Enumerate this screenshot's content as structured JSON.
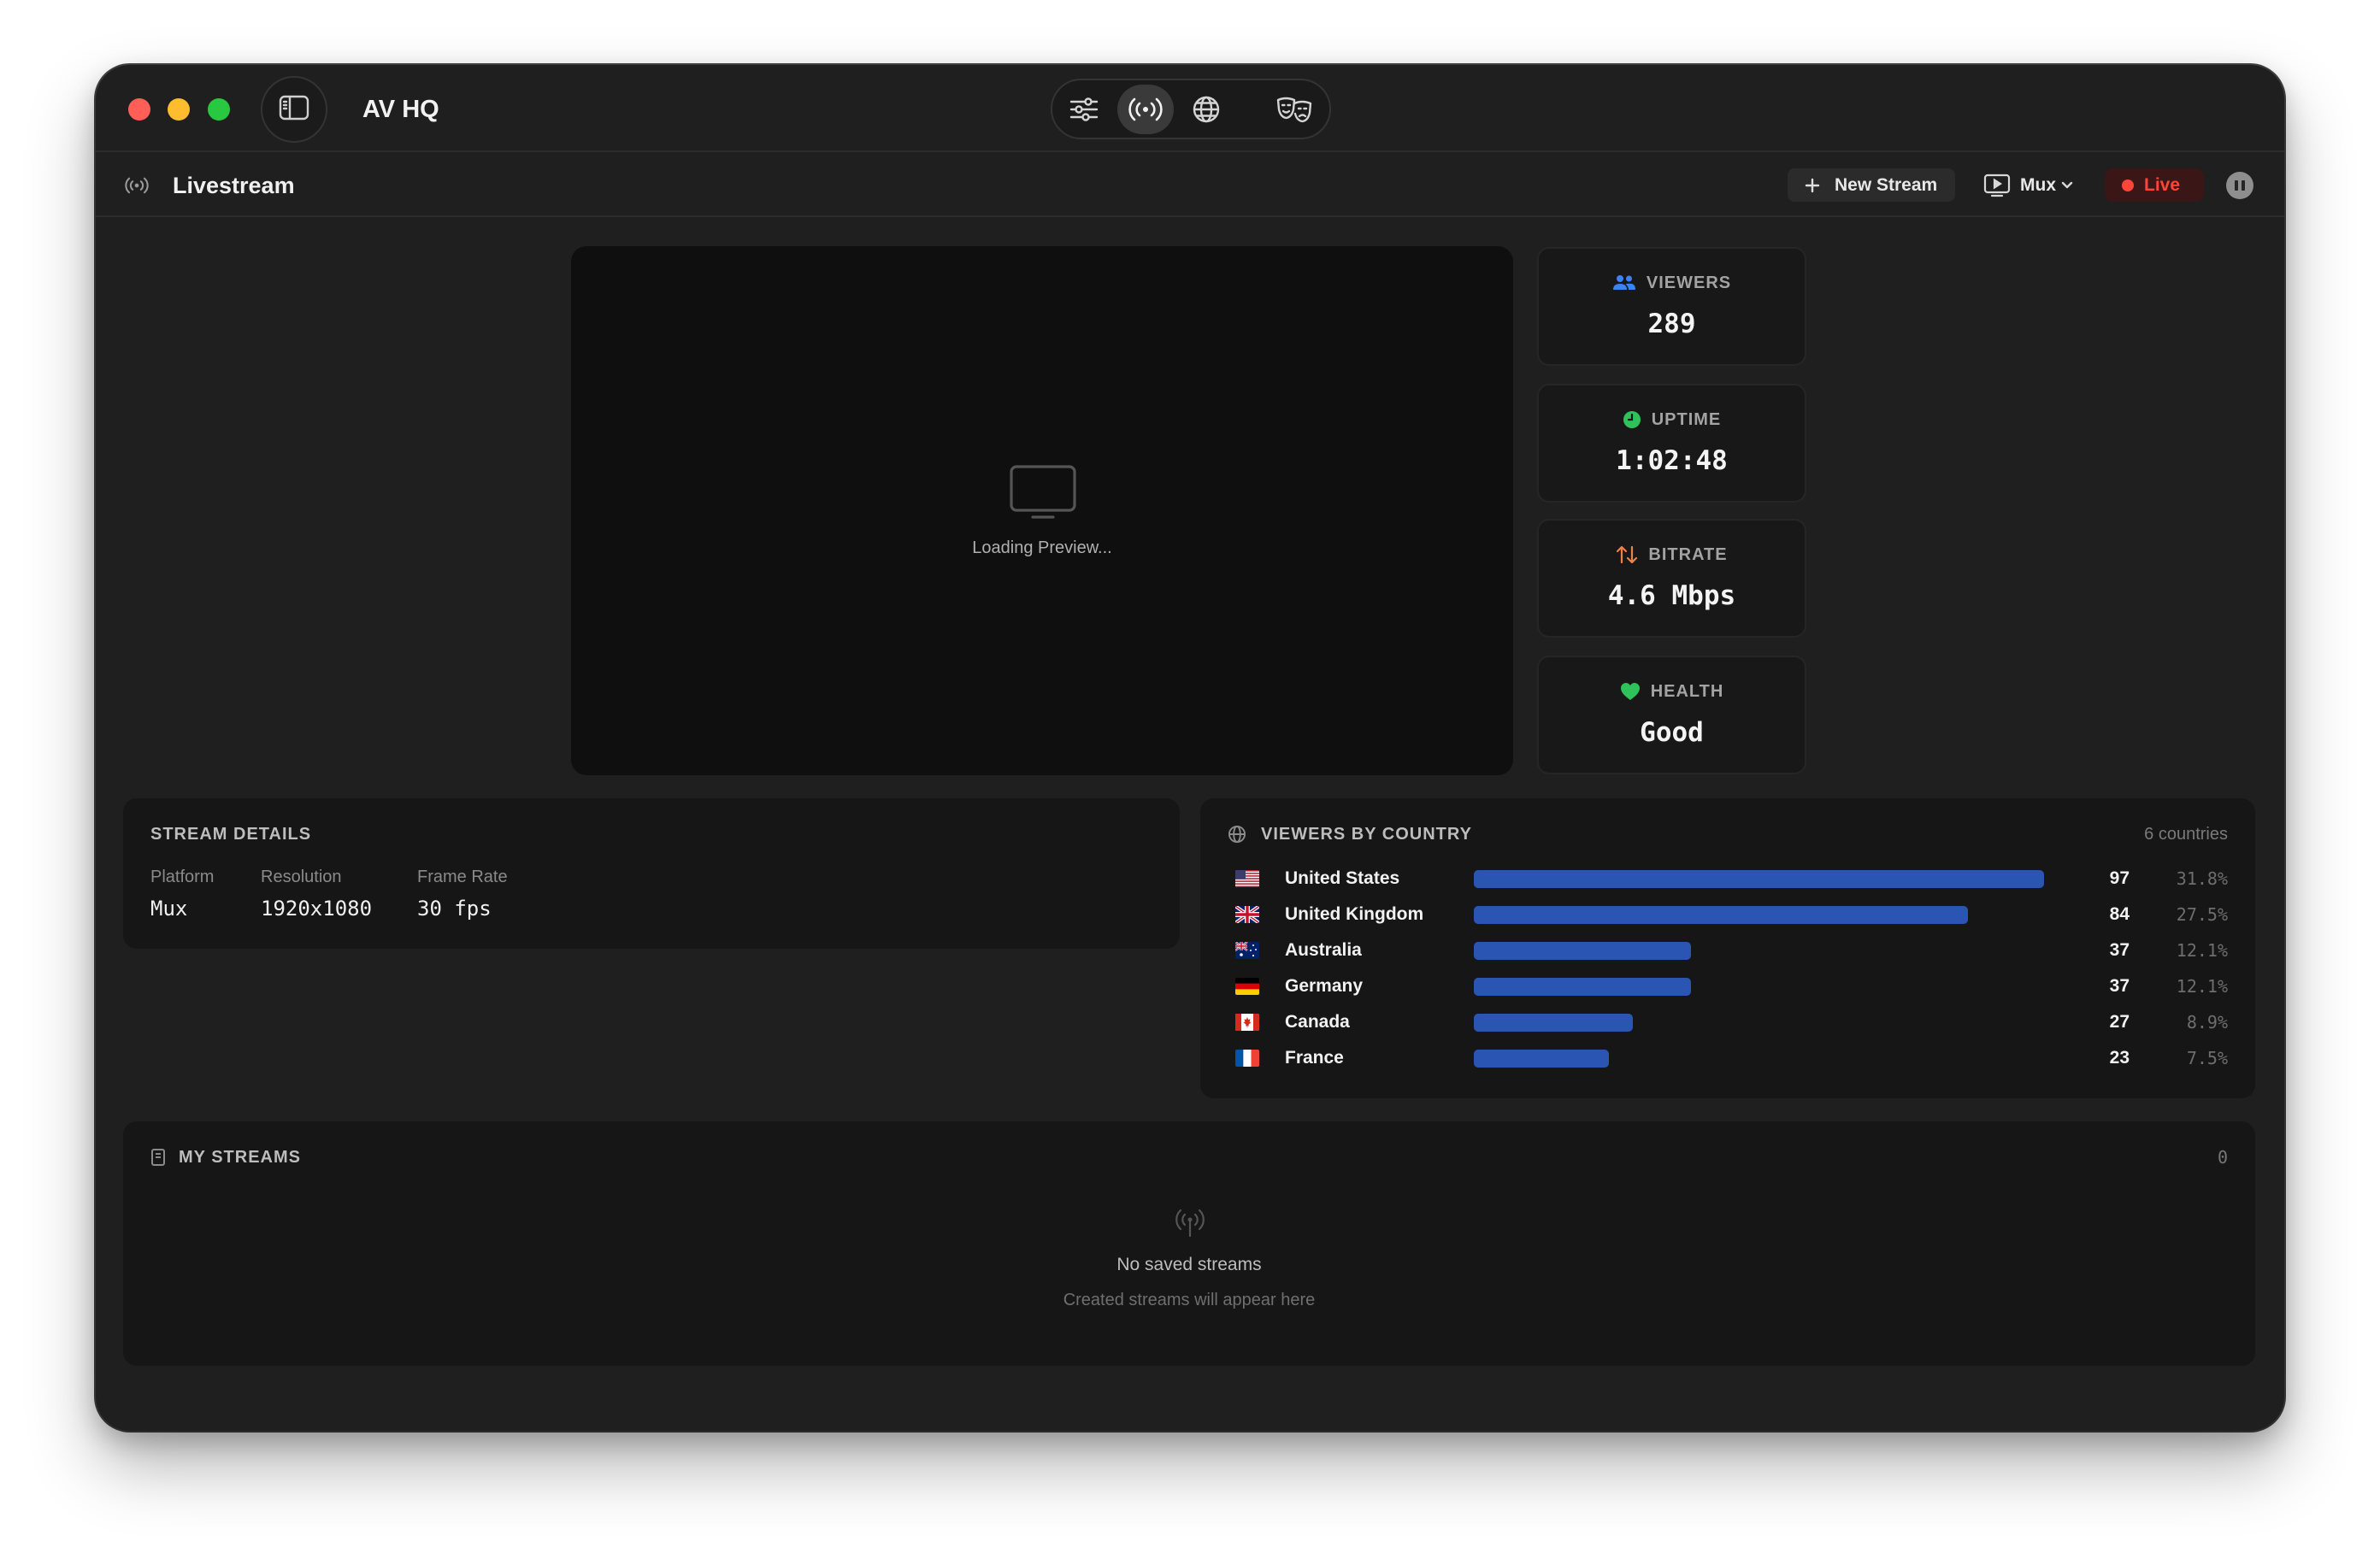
{
  "window": {
    "title": "AV HQ"
  },
  "toolbar": {
    "icons": [
      {
        "name": "sliders-icon",
        "selected": false
      },
      {
        "name": "broadcast-icon",
        "selected": true
      },
      {
        "name": "globe-icon",
        "selected": false
      },
      {
        "name": "theater-masks-icon",
        "selected": false
      }
    ]
  },
  "header": {
    "icon": "broadcast-icon",
    "title": "Livestream",
    "new_stream_label": "New Stream",
    "platform": "Mux",
    "live_label": "Live"
  },
  "preview": {
    "loading_text": "Loading Preview..."
  },
  "stats": [
    {
      "label": "VIEWERS",
      "value": "289",
      "icon": "users-icon",
      "color": "#3b82f6"
    },
    {
      "label": "UPTIME",
      "value": "1:02:48",
      "icon": "clock-icon",
      "color": "#30c25a"
    },
    {
      "label": "BITRATE",
      "value": "4.6 Mbps",
      "icon": "arrows-up-down-icon",
      "color": "#e8834a"
    },
    {
      "label": "HEALTH",
      "value": "Good",
      "icon": "heart-icon",
      "color": "#30c25a"
    }
  ],
  "stream_details": {
    "title": "STREAM DETAILS",
    "fields": [
      {
        "label": "Platform",
        "value": "Mux"
      },
      {
        "label": "Resolution",
        "value": "1920x1080"
      },
      {
        "label": "Frame Rate",
        "value": "30 fps"
      }
    ]
  },
  "viewers_by_country": {
    "title": "VIEWERS BY COUNTRY",
    "summary": "6 countries",
    "bar_color": "#2b55b3",
    "rows": [
      {
        "flag": "flag-us-icon",
        "country": "United States",
        "viewers": 97,
        "percent": "31.8%"
      },
      {
        "flag": "flag-gb-icon",
        "country": "United Kingdom",
        "viewers": 84,
        "percent": "27.5%"
      },
      {
        "flag": "flag-au-icon",
        "country": "Australia",
        "viewers": 37,
        "percent": "12.1%"
      },
      {
        "flag": "flag-de-icon",
        "country": "Germany",
        "viewers": 37,
        "percent": "12.1%"
      },
      {
        "flag": "flag-ca-icon",
        "country": "Canada",
        "viewers": 27,
        "percent": "8.9%"
      },
      {
        "flag": "flag-fr-icon",
        "country": "France",
        "viewers": 23,
        "percent": "7.5%"
      }
    ]
  },
  "my_streams": {
    "title": "MY STREAMS",
    "count": "0",
    "empty_icon": "antenna-icon",
    "empty_title": "No saved streams",
    "empty_subtitle": "Created streams will appear here"
  },
  "colors": {
    "live": "#ff453a",
    "live_bg": "#3a1716"
  }
}
